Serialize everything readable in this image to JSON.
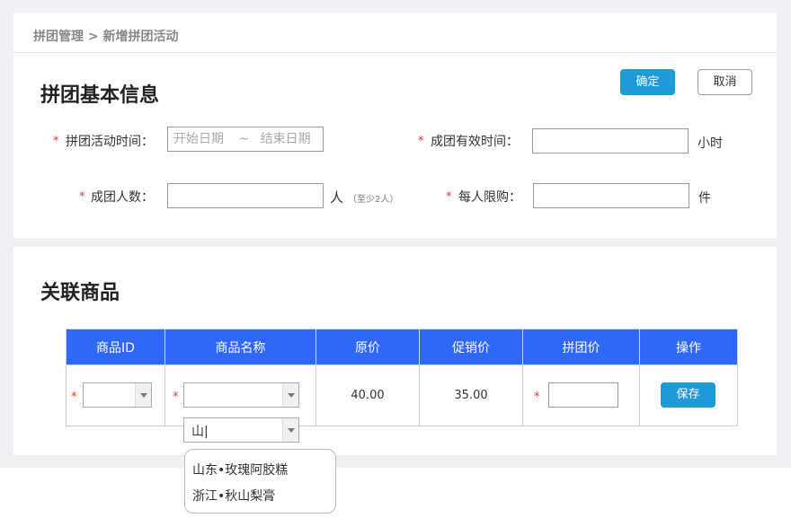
{
  "breadcrumb": "拼团管理 > 新增拼团活动",
  "basic": {
    "title": "拼团基本信息",
    "confirm_label": "确定",
    "cancel_label": "取消",
    "required_mark": "*",
    "time_label": "拼团活动时间：",
    "start_placeholder": "开始日期",
    "range_sep": "~",
    "end_placeholder": "结束日期",
    "valid_label": "成团有效时间：",
    "valid_unit": "小时",
    "people_label": "成团人数：",
    "people_unit": "人",
    "people_hint": "（至少2人）",
    "limit_label": "每人限购：",
    "limit_unit": "件"
  },
  "goods": {
    "title": "关联商品",
    "columns": [
      "商品ID",
      "商品名称",
      "原价",
      "促销价",
      "拼团价",
      "操作"
    ],
    "row": {
      "original_price": "40.00",
      "promo_price": "35.00",
      "save_label": "保存"
    },
    "search_value": "山|",
    "options": [
      "山东•玫瑰阿胶糕",
      "浙江•秋山梨膏"
    ]
  }
}
